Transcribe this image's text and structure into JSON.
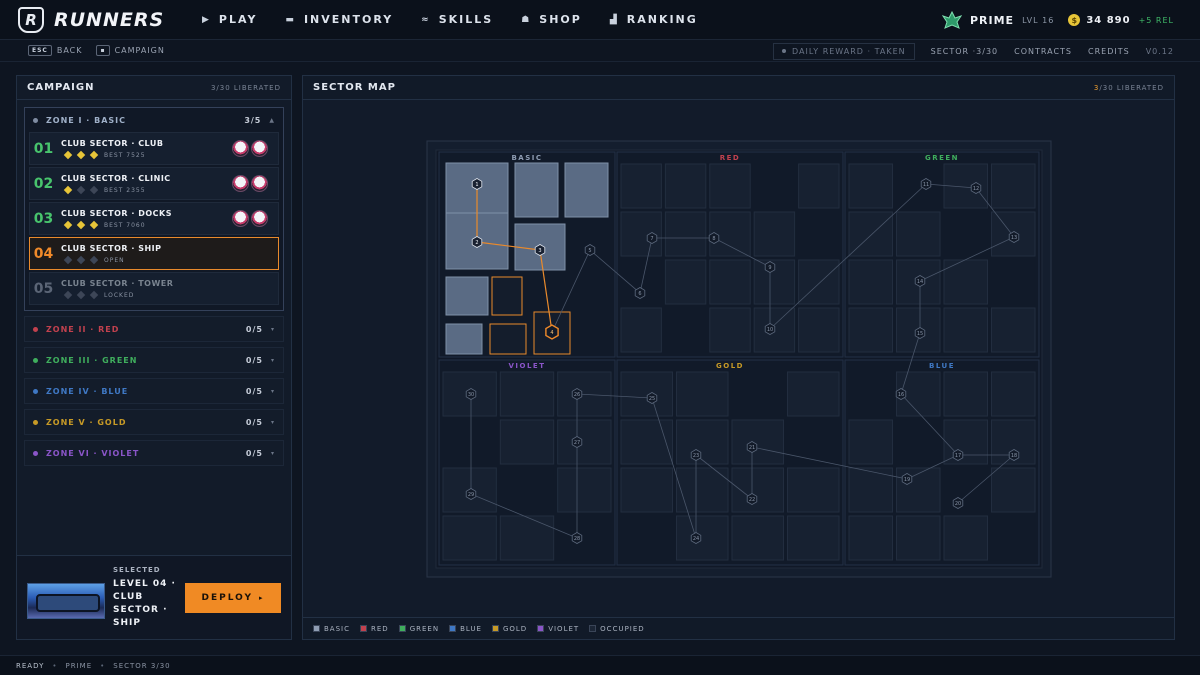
{
  "topbar": {
    "logo_text": "RUNNERS",
    "logo_letter": "R",
    "nav": [
      {
        "label": "PLAY",
        "icon": "play-icon",
        "glyph": "▶"
      },
      {
        "label": "INVENTORY",
        "icon": "bag-icon",
        "glyph": "▬"
      },
      {
        "label": "SKILLS",
        "icon": "chevrons-up-icon",
        "glyph": "≈"
      },
      {
        "label": "SHOP",
        "icon": "shop-icon",
        "glyph": "☗"
      },
      {
        "label": "RANKING",
        "icon": "podium-icon",
        "glyph": "▟"
      }
    ],
    "player_name": "PRIME",
    "player_level": "LVL 16",
    "credits": "34 890",
    "rel": "+5 REL"
  },
  "subbar": {
    "back_key": "ESC",
    "back_label": "BACK",
    "campaign_key": "▪",
    "campaign_label": "CAMPAIGN",
    "daily": "DAILY REWARD · TAKEN",
    "sector": "SECTOR ·3/30",
    "contracts": "CONTRACTS",
    "credits": "CREDITS",
    "version": "V0.12"
  },
  "campaign": {
    "title": "CAMPAIGN",
    "count": "3/30 LIBERATED",
    "open_zone": {
      "name": "ZONE I · BASIC",
      "count": "3/5",
      "color": "#8f9db3"
    },
    "levels": [
      {
        "num": "01",
        "name": "CLUB SECTOR · CLUB",
        "stars": 3,
        "meta": "BEST 7525",
        "skulls": 2,
        "state": "done"
      },
      {
        "num": "02",
        "name": "CLUB SECTOR · CLINIC",
        "stars": 1,
        "meta": "BEST 2355",
        "skulls": 2,
        "state": "done"
      },
      {
        "num": "03",
        "name": "CLUB SECTOR · DOCKS",
        "stars": 3,
        "meta": "BEST 7060",
        "skulls": 2,
        "state": "done"
      },
      {
        "num": "04",
        "name": "CLUB SECTOR · SHIP",
        "stars": 0,
        "meta": "OPEN",
        "skulls": 0,
        "state": "selected"
      },
      {
        "num": "05",
        "name": "CLUB SECTOR · TOWER",
        "stars": 0,
        "meta": "LOCKED",
        "skulls": 0,
        "state": "locked"
      }
    ],
    "zones": [
      {
        "name": "ZONE II · RED",
        "count": "0/5",
        "color": "#c2414e"
      },
      {
        "name": "ZONE III · GREEN",
        "count": "0/5",
        "color": "#3fae5d"
      },
      {
        "name": "ZONE IV · BLUE",
        "count": "0/5",
        "color": "#3f78c4"
      },
      {
        "name": "ZONE V · GOLD",
        "count": "0/5",
        "color": "#c79a26"
      },
      {
        "name": "ZONE VI · VIOLET",
        "count": "0/5",
        "color": "#8a55c8"
      }
    ],
    "selected": {
      "label": "SELECTED",
      "name": "LEVEL 04 · CLUB SECTOR · SHIP",
      "deploy": "DEPLOY"
    }
  },
  "map": {
    "title": "SECTOR MAP",
    "count_hl": "3",
    "count_rest": "/30 LIBERATED",
    "regions": [
      {
        "label": "BASIC",
        "color": "#8f9db3"
      },
      {
        "label": "RED",
        "color": "#c2414e"
      },
      {
        "label": "GREEN",
        "color": "#3fae5d"
      },
      {
        "label": "VIOLET",
        "color": "#8a55c8"
      },
      {
        "label": "GOLD",
        "color": "#c79a26"
      },
      {
        "label": "BLUE",
        "color": "#3f78c4"
      }
    ],
    "nodes": [
      "1",
      "2",
      "3",
      "4",
      "5",
      "6",
      "7",
      "8",
      "9",
      "10",
      "11",
      "12",
      "13",
      "14",
      "15",
      "16",
      "17",
      "18",
      "19",
      "20",
      "21",
      "22",
      "23",
      "24",
      "25",
      "26",
      "27",
      "28",
      "29",
      "30"
    ]
  },
  "legend": [
    {
      "label": "BASIC",
      "color": "#8f9db3"
    },
    {
      "label": "RED",
      "color": "#c2414e"
    },
    {
      "label": "GREEN",
      "color": "#3fae5d"
    },
    {
      "label": "BLUE",
      "color": "#3f78c4"
    },
    {
      "label": "GOLD",
      "color": "#c79a26"
    },
    {
      "label": "VIOLET",
      "color": "#8a55c8"
    },
    {
      "label": "OCCUPIED",
      "color": "#1c2636"
    }
  ],
  "status": {
    "ready": "READY",
    "player": "PRIME",
    "sector": "SECTOR 3/30"
  }
}
